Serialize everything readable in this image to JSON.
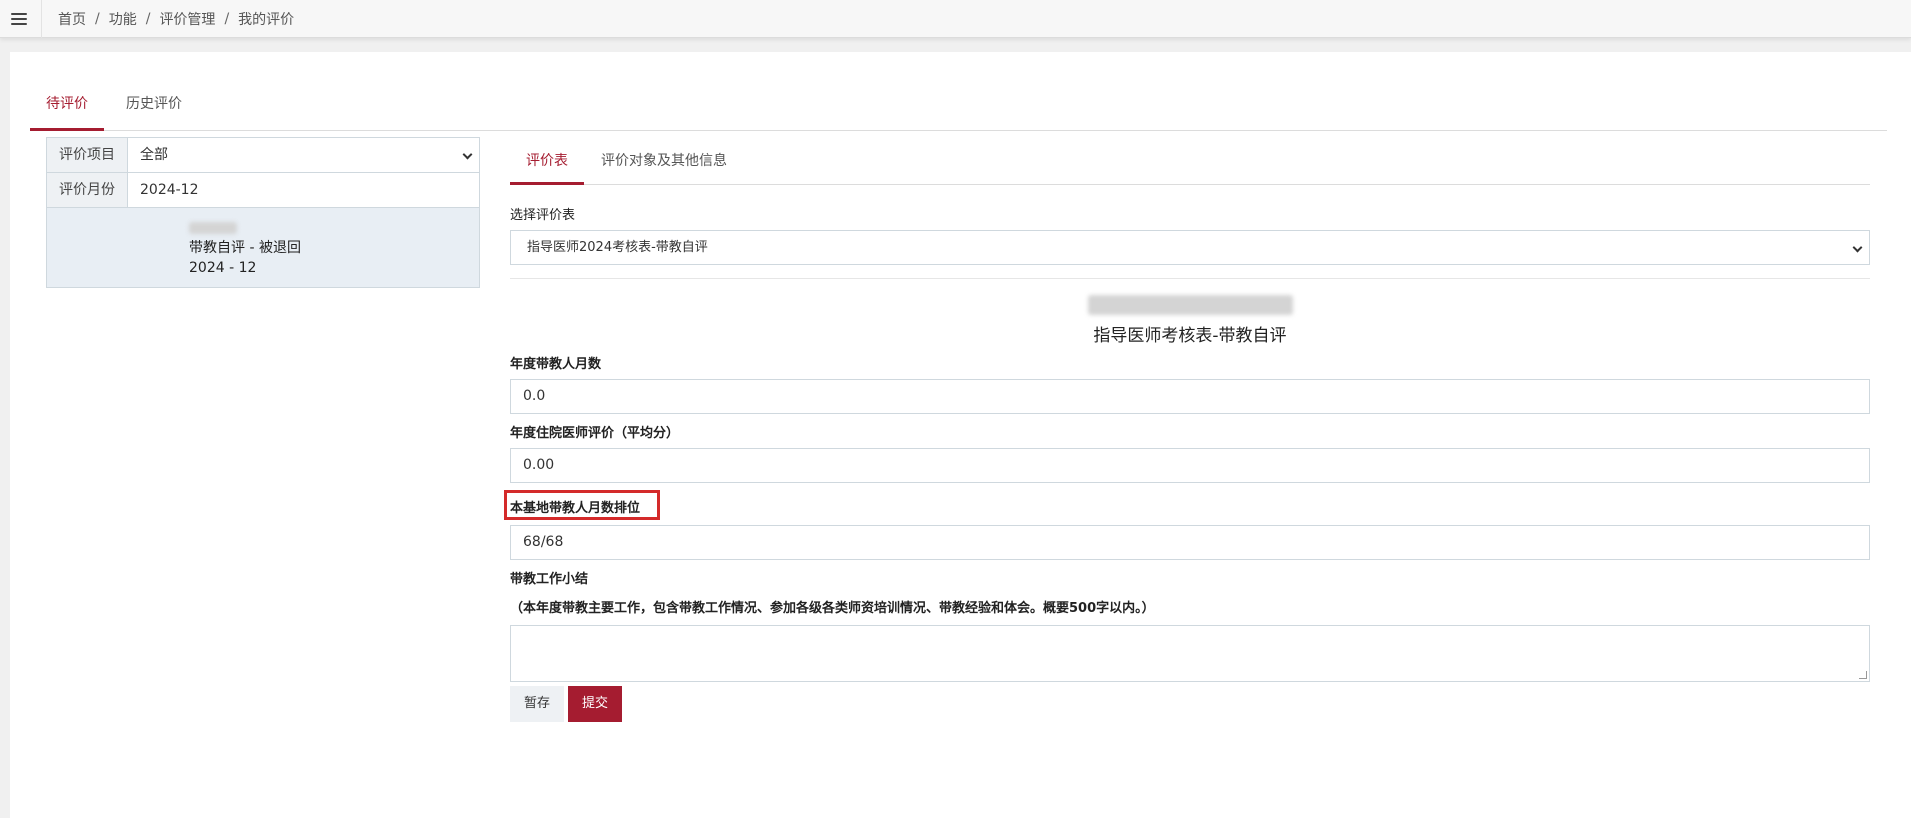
{
  "breadcrumb": {
    "items": [
      "首页",
      "功能",
      "评价管理",
      "我的评价"
    ],
    "separator": "/"
  },
  "main_tabs": [
    {
      "label": "待评价",
      "active": true
    },
    {
      "label": "历史评价",
      "active": false
    }
  ],
  "filters": {
    "project_label": "评价项目",
    "project_value": "全部",
    "month_label": "评价月份",
    "month_value": "2024-12"
  },
  "record": {
    "type_status": "带教自评 - 被退回",
    "period": "2024 - 12"
  },
  "sub_tabs": [
    {
      "label": "评价表",
      "active": true
    },
    {
      "label": "评价对象及其他信息",
      "active": false
    }
  ],
  "form": {
    "select_label": "选择评价表",
    "select_value": "指导医师2024考核表-带教自评",
    "title": "指导医师考核表-带教自评",
    "fields": [
      {
        "label": "年度带教人月数",
        "value": "0.0"
      },
      {
        "label": "年度住院医师评价（平均分）",
        "value": "0.00"
      },
      {
        "label": "本基地带教人月数排位",
        "value": "68/68"
      }
    ],
    "summary_label": "带教工作小结",
    "summary_hint": "（本年度带教主要工作，包含带教工作情况、参加各级各类师资培训情况、带教经验和体会。概要500字以内。）",
    "save_label": "暂存",
    "submit_label": "提交"
  },
  "colors": {
    "accent": "#a51c30",
    "highlight": "#d42a2a"
  }
}
